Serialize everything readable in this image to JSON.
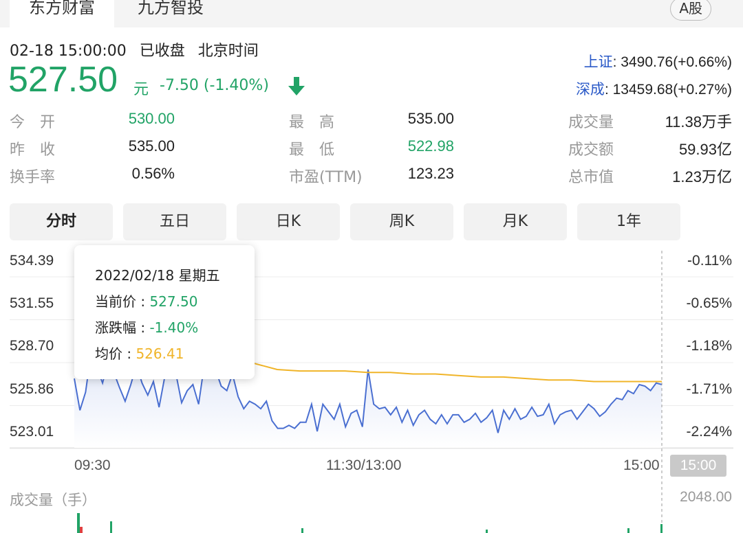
{
  "tabs": {
    "active": "东方财富",
    "other": "九方智投",
    "badge": "A股"
  },
  "header": {
    "time": "02-18 15:00:00",
    "status": "已收盘",
    "timezone": "北京时间",
    "price": "527.50",
    "unit": "元",
    "change": "-7.50 (-1.40%)"
  },
  "indices": [
    {
      "name": "上证",
      "value": ": 3490.76(+0.66%)"
    },
    {
      "name": "深成",
      "value": ": 13459.68(+0.27%)"
    }
  ],
  "stats": {
    "open_label": "今　开",
    "open_value": "530.00",
    "prev_label": "昨　收",
    "prev_value": "535.00",
    "turnover_label": "换手率",
    "turnover_value": "0.56%",
    "high_label": "最　高",
    "high_value": "535.00",
    "low_label": "最　低",
    "low_value": "522.98",
    "pe_label": "市盈(TTM)",
    "pe_value": "123.23",
    "volume_label": "成交量",
    "volume_value": "11.38万手",
    "amount_label": "成交额",
    "amount_value": "59.93亿",
    "cap_label": "总市值",
    "cap_value": "1.23万亿"
  },
  "chart_tabs": [
    "分时",
    "五日",
    "日K",
    "周K",
    "月K",
    "1年"
  ],
  "chart": {
    "y_left": [
      "534.39",
      "531.55",
      "528.70",
      "525.86",
      "523.01"
    ],
    "y_right": [
      "-0.11%",
      "-0.65%",
      "-1.18%",
      "-1.71%",
      "-2.24%"
    ],
    "x_labels": [
      "09:30",
      "11:30/13:00",
      "15:00"
    ],
    "x_badge": "15:00"
  },
  "tooltip": {
    "date": "2022/02/18 星期五",
    "price_label": "当前价 : ",
    "price_value": "527.50",
    "change_label": "涨跌幅 : ",
    "change_value": "-1.40%",
    "avg_label": "均价 : ",
    "avg_value": "526.41"
  },
  "volume": {
    "label": "成交量（手）",
    "max": "2048.00"
  },
  "colors": {
    "down": "#21a366",
    "price_line": "#4a6fd1",
    "avg_line": "#f0b428",
    "index_name": "#2b5ac8"
  },
  "chart_data": {
    "type": "line",
    "series": [
      {
        "name": "当前价",
        "values": [
          526.6,
          524.5,
          525.7,
          528.4,
          527.3,
          526.3,
          527.8,
          527.0,
          526.0,
          525.1,
          526.2,
          527.5,
          526.3,
          525.5,
          526.4,
          524.7,
          526.7,
          527.4,
          526.9,
          525.0,
          525.8,
          526.2,
          524.9,
          527.5,
          528.2,
          527.2,
          526.1,
          525.8,
          526.9,
          525.4,
          524.6,
          525.1,
          524.9,
          524.6,
          525.1,
          523.8,
          523.3,
          523.3,
          523.5,
          523.3,
          523.7,
          523.7,
          524.9,
          523.1,
          524.9,
          524.4,
          523.9,
          524.9,
          523.4,
          524.3,
          524.5,
          523.4,
          527.2,
          524.9,
          524.6,
          524.7,
          524.2,
          524.7,
          523.7,
          524.5,
          523.5,
          524.2,
          524.5,
          523.9,
          523.6,
          524.2,
          523.6,
          524.2,
          524.2,
          523.7,
          523.9,
          524.3,
          523.7,
          524.0,
          524.5,
          523.0,
          524.5,
          523.9,
          524.6,
          523.9,
          524.1,
          524.7,
          524.1,
          524.2,
          524.9,
          523.6,
          524.2,
          524.4,
          524.5,
          523.9,
          524.4,
          524.9,
          524.6,
          524.1,
          524.4,
          524.9,
          525.3,
          525.2,
          525.8,
          525.6,
          526.2,
          526.1,
          525.8,
          526.3,
          526.2
        ]
      },
      {
        "name": "均价",
        "values": [
          527.6,
          527.2,
          527.1,
          527.1,
          527.1,
          527.0,
          527.0,
          526.9,
          526.9,
          526.8,
          526.7,
          526.7,
          526.6,
          526.5,
          526.5,
          526.4,
          526.4,
          526.4,
          526.4
        ]
      }
    ],
    "x": [
      "09:30",
      "11:30/13:00",
      "15:00"
    ],
    "ylim": [
      523.01,
      534.39
    ]
  }
}
